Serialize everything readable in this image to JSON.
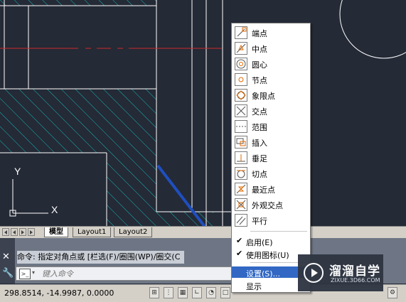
{
  "colors": {
    "canvas_bg": "#242a36",
    "hatch": "#17b9b9",
    "center_line": "#cc2a2a",
    "highlight": "#3268c4",
    "arrow": "#1f4fbf"
  },
  "layout_tabs": {
    "tabs": [
      "模型",
      "Layout1",
      "Layout2"
    ],
    "active": "模型"
  },
  "ucs": {
    "y_axis": "Y",
    "x_axis": "X"
  },
  "command": {
    "history": "命令: 指定对角点或 [栏选(F)/圈围(WP)/圈交(C",
    "placeholder": "键入命令"
  },
  "status": {
    "coordinates": "298.8514, -14.9987, 0.0000"
  },
  "osnap_menu": {
    "snap_items": [
      {
        "label": "端点",
        "icon": "endpoint-icon"
      },
      {
        "label": "中点",
        "icon": "midpoint-icon"
      },
      {
        "label": "圆心",
        "icon": "center-icon"
      },
      {
        "label": "节点",
        "icon": "node-icon"
      },
      {
        "label": "象限点",
        "icon": "quadrant-icon"
      },
      {
        "label": "交点",
        "icon": "intersection-icon"
      },
      {
        "label": "范围",
        "icon": "extension-icon"
      },
      {
        "label": "插入",
        "icon": "insertion-icon"
      },
      {
        "label": "垂足",
        "icon": "perpendicular-icon"
      },
      {
        "label": "切点",
        "icon": "tangent-icon"
      },
      {
        "label": "最近点",
        "icon": "nearest-icon"
      },
      {
        "label": "外观交点",
        "icon": "apparent-intersection-icon"
      },
      {
        "label": "平行",
        "icon": "parallel-icon"
      }
    ],
    "options": [
      {
        "label": "启用(E)",
        "checked": true
      },
      {
        "label": "使用图标(U)",
        "checked": true
      },
      {
        "label": "设置(S)...",
        "checked": false,
        "highlighted": true
      },
      {
        "label": "显示",
        "checked": false
      }
    ]
  },
  "watermark": {
    "title": "溜溜自学",
    "url": "ZIXUE.3D66.COM"
  }
}
